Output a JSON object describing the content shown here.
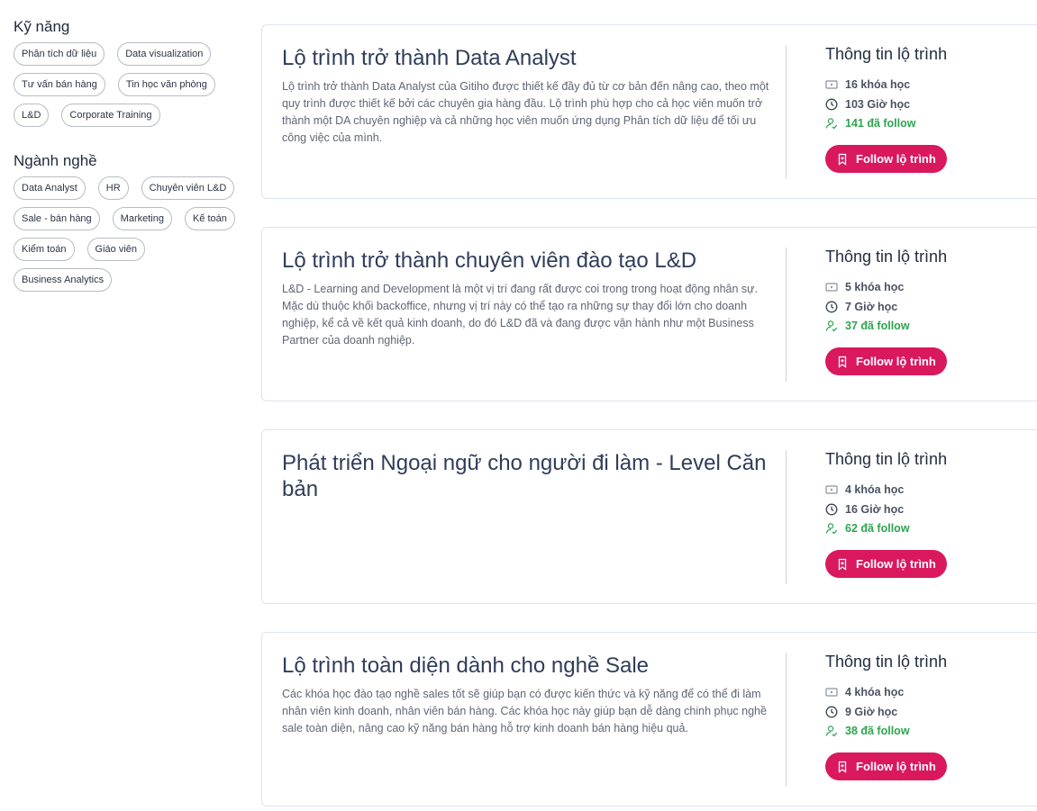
{
  "sidebar": {
    "skills": {
      "title": "Kỹ năng",
      "tags": [
        "Phân tích dữ liệu",
        "Data visualization",
        "Tư vấn bán hàng",
        "Tin học văn phòng",
        "L&D",
        "Corporate Training"
      ]
    },
    "industries": {
      "title": "Ngành nghề",
      "tags": [
        "Data Analyst",
        "HR",
        "Chuyên viên L&D",
        "Sale - bán hàng",
        "Marketing",
        "Kế toán",
        "Kiểm toán",
        "Giáo viên",
        "Business Analytics"
      ]
    }
  },
  "cards": [
    {
      "title": "Lộ trình trở thành Data Analyst",
      "description": "Lộ trình trở thành Data Analyst của Gitiho được thiết kế đầy đủ từ cơ bản đến nâng cao, theo một quy trình được thiết kế bởi các chuyên gia hàng đầu. Lộ trình phù hợp cho cả học viên muốn trở thành một DA chuyên nghiệp và cả những học viên muốn ứng dụng Phân tích dữ liệu để tối ưu công việc của mình.",
      "info_title": "Thông tin lộ trình",
      "courses": "16 khóa học",
      "hours": "103 Giờ học",
      "follows": "141 đã follow",
      "button": "Follow lộ trình"
    },
    {
      "title": "Lộ trình trở thành chuyên viên đào tạo L&D",
      "description": "L&D - Learning and Development là một vị trí đang rất được coi trong trong hoạt động nhân sự. Mặc dù thuộc khối backoffice, nhưng vị trí này có thể tạo ra những sự thay đổi lớn cho doanh nghiệp, kể cả về kết quả kinh doanh, do đó L&D đã và đang được vận hành như một Business Partner của doanh nghiệp.",
      "info_title": "Thông tin lộ trình",
      "courses": "5 khóa học",
      "hours": "7 Giờ học",
      "follows": "37 đã follow",
      "button": "Follow lộ trình"
    },
    {
      "title": "Phát triển Ngoại ngữ cho người đi làm - Level Căn bản",
      "description": "",
      "info_title": "Thông tin lộ trình",
      "courses": "4 khóa học",
      "hours": "16 Giờ học",
      "follows": "62 đã follow",
      "button": "Follow lộ trình"
    },
    {
      "title": "Lộ trình toàn diện dành cho nghề Sale",
      "description": "Các khóa học đào tạo nghề sales tốt sẽ giúp bạn có được kiến thức và kỹ năng để có thể đi làm nhân viên kinh doanh, nhân viên bán hàng. Các khóa học này giúp bạn dễ dàng chinh phục nghề sale toàn diện, nâng cao kỹ năng bán hàng hỗ trợ kinh doanh bán hàng hiệu quả.",
      "info_title": "Thông tin lộ trình",
      "courses": "4 khóa học",
      "hours": "9 Giờ học",
      "follows": "38 đã follow",
      "button": "Follow lộ trình"
    }
  ],
  "colors": {
    "accent": "#d9185e",
    "follow_green": "#2ea44f"
  },
  "icons": {
    "courses": "video-icon",
    "hours": "clock-icon",
    "follows": "user-check-icon",
    "button": "bookmark-icon"
  }
}
